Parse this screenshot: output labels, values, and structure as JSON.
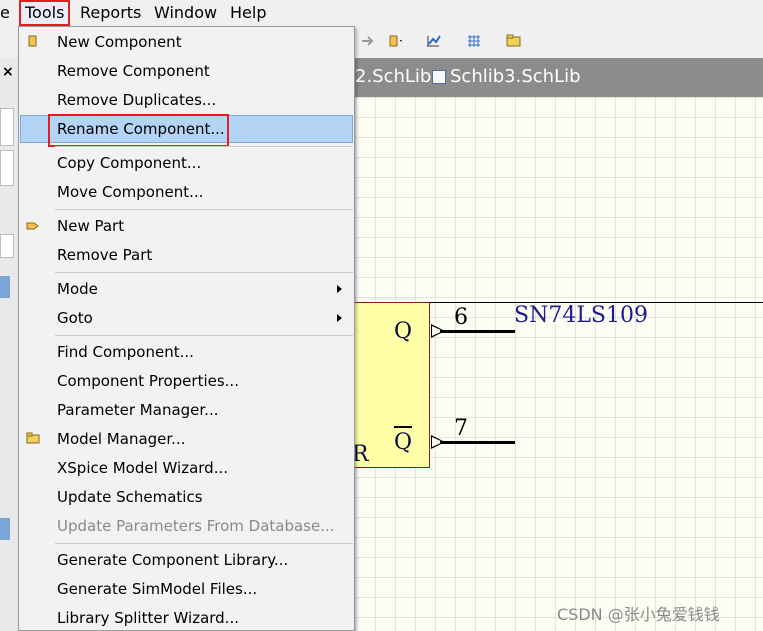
{
  "menubar": {
    "items": [
      {
        "label": "e"
      },
      {
        "label": "Tools",
        "mnemonic": "T"
      },
      {
        "label": "Reports",
        "mnemonic": "R"
      },
      {
        "label": "Window",
        "mnemonic": "W"
      },
      {
        "label": "Help",
        "mnemonic": "H"
      }
    ]
  },
  "tabs": [
    {
      "label": "2.SchLib"
    },
    {
      "label": "Schlib3.SchLib"
    }
  ],
  "tools_menu": {
    "items": [
      {
        "label": "New Component",
        "icon": "component-icon"
      },
      {
        "label": "Remove Component"
      },
      {
        "label": "Remove Duplicates..."
      },
      {
        "label": "Rename Component...",
        "highlighted": true
      },
      {
        "label": "Copy Component..."
      },
      {
        "label": "Move Component..."
      },
      {
        "label": "New Part",
        "icon": "new-part-icon"
      },
      {
        "label": "Remove Part"
      },
      {
        "label": "Mode",
        "submenu": true
      },
      {
        "label": "Goto",
        "submenu": true
      },
      {
        "label": "Find Component..."
      },
      {
        "label": "Component Properties..."
      },
      {
        "label": "Parameter Manager..."
      },
      {
        "label": "Model Manager...",
        "icon": "folder-icon"
      },
      {
        "label": "XSpice Model Wizard..."
      },
      {
        "label": "Update Schematics"
      },
      {
        "label": "Update Parameters From Database...",
        "disabled": true
      },
      {
        "label": "Generate Component Library..."
      },
      {
        "label": "Generate SimModel Files..."
      },
      {
        "label": "Library Splitter Wizard..."
      }
    ]
  },
  "schematic": {
    "component_name": "SN74LS109",
    "pins": [
      {
        "name": "Q",
        "number": "6"
      },
      {
        "name": "Q",
        "number": "7",
        "inverted": true
      }
    ],
    "partial_label": "R"
  },
  "watermark": "CSDN @张小兔爱钱钱",
  "colors": {
    "highlight": "#b3d4f5",
    "annotation_box": "#e02020",
    "component_fill": "#ffffa8",
    "tab_strip": "#8c8c8c"
  }
}
